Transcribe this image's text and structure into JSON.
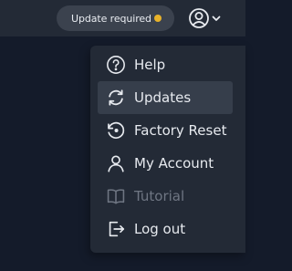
{
  "topbar": {
    "update_label": "Update required",
    "update_dot_color": "#e8b22a",
    "profile_icon": "user-circle-icon",
    "chevron_icon": "chevron-down-icon"
  },
  "menu": {
    "items": [
      {
        "label": "Help",
        "icon": "help-circle-icon",
        "state": "normal"
      },
      {
        "label": "Updates",
        "icon": "refresh-icon",
        "state": "active"
      },
      {
        "label": "Factory Reset",
        "icon": "history-reset-icon",
        "state": "normal"
      },
      {
        "label": "My Account",
        "icon": "user-icon",
        "state": "normal"
      },
      {
        "label": "Tutorial",
        "icon": "book-icon",
        "state": "disabled"
      },
      {
        "label": "Log out",
        "icon": "logout-icon",
        "state": "normal"
      }
    ]
  },
  "colors": {
    "background": "#141b2a",
    "panel": "#232a36",
    "active_item": "#363e4b",
    "text": "#e7eaef",
    "disabled_text": "#6f7683"
  }
}
